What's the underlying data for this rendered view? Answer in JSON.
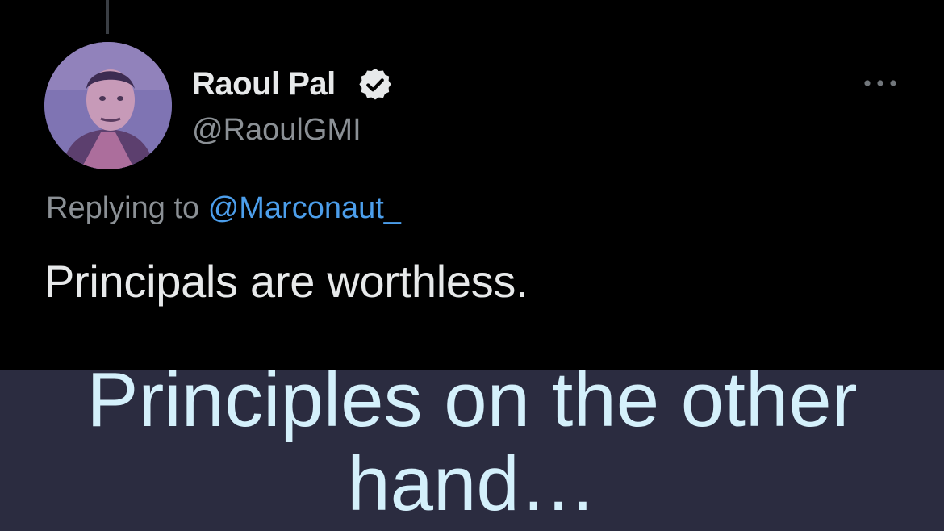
{
  "tweet": {
    "author": {
      "display_name": "Raoul Pal",
      "handle": "@RaoulGMI",
      "verified": true,
      "avatar_icon": "profile-photo"
    },
    "reply": {
      "prefix": "Replying to",
      "mention": "@Marconaut_"
    },
    "text": "Principals are worthless.",
    "more_icon": "ellipsis-icon"
  },
  "caption": {
    "line1": "Principles on the other",
    "line2": "hand…"
  },
  "colors": {
    "background": "#000000",
    "primary_text": "#e7e9ea",
    "secondary_text": "#8b9095",
    "mention": "#4c9eeb",
    "caption_band": "#2b2c40",
    "caption_text": "#d4f0fb"
  }
}
